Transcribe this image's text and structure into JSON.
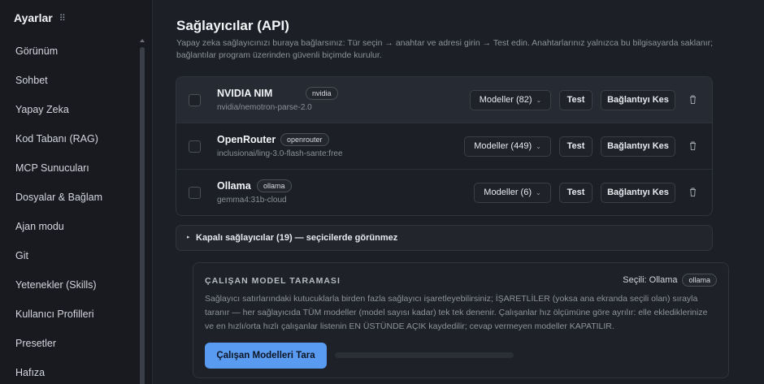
{
  "sidebar": {
    "title": "Ayarlar",
    "drag_icon": "drag-handle-icon",
    "items": [
      {
        "label": "Görünüm"
      },
      {
        "label": "Sohbet"
      },
      {
        "label": "Yapay Zeka"
      },
      {
        "label": "Kod Tabanı (RAG)"
      },
      {
        "label": "MCP Sunucuları"
      },
      {
        "label": "Dosyalar & Bağlam"
      },
      {
        "label": "Ajan modu"
      },
      {
        "label": "Git"
      },
      {
        "label": "Yetenekler (Skills)"
      },
      {
        "label": "Kullanıcı Profilleri"
      },
      {
        "label": "Presetler"
      },
      {
        "label": "Hafıza"
      }
    ]
  },
  "main": {
    "title": "Sağlayıcılar (API)",
    "description": "Yapay zeka sağlayıcınızı buraya bağlarsınız: Tür seçin → anahtar ve adresi girin → Test edin. Anahtarlarınız yalnızca bu bilgisayarda saklanır; bağlantılar program üzerinden güvenli biçimde kurulur."
  },
  "providers": [
    {
      "name": "NVIDIA NIM",
      "tag": "nvidia",
      "model": "nvidia/nemotron-parse-2.0",
      "models_button": "Modeller (82)",
      "test_label": "Test",
      "disconnect_label": "Bağlantıyı Kes"
    },
    {
      "name": "OpenRouter",
      "tag": "openrouter",
      "model": "inclusionai/ling-3.0-flash-sante:free",
      "models_button": "Modeller (449)",
      "test_label": "Test",
      "disconnect_label": "Bağlantıyı Kes"
    },
    {
      "name": "Ollama",
      "tag": "ollama",
      "model": "gemma4:31b-cloud",
      "models_button": "Modeller (6)",
      "test_label": "Test",
      "disconnect_label": "Bağlantıyı Kes"
    }
  ],
  "collapsed": {
    "arrow": "▸",
    "label": "Kapalı sağlayıcılar (19) — seçicilerde görünmez"
  },
  "scan": {
    "title": "ÇALIŞAN MODEL TARAMASI",
    "selected_label": "Seçili: Ollama",
    "selected_tag": "ollama",
    "description": "Sağlayıcı satırlarındaki kutucuklarla birden fazla sağlayıcı işaretleyebilirsiniz; İŞARETLİLER (yoksa ana ekranda seçili olan) sırayla taranır — her sağlayıcıda TÜM modeller (model sayısı kadar) tek tek denenir. Çalışanlar hız ölçümüne göre ayrılır: elle eklediklerinize ve en hızlı/orta hızlı çalışanlar listenin EN ÜSTÜNDE AÇIK kaydedilir; cevap vermeyen modeller KAPATILIR.",
    "button_label": "Çalışan Modelleri Tara",
    "progress": 0
  },
  "colors": {
    "accent": "#5a9bf2",
    "background": "#1c1f25",
    "sidebar": "#181a1f"
  }
}
